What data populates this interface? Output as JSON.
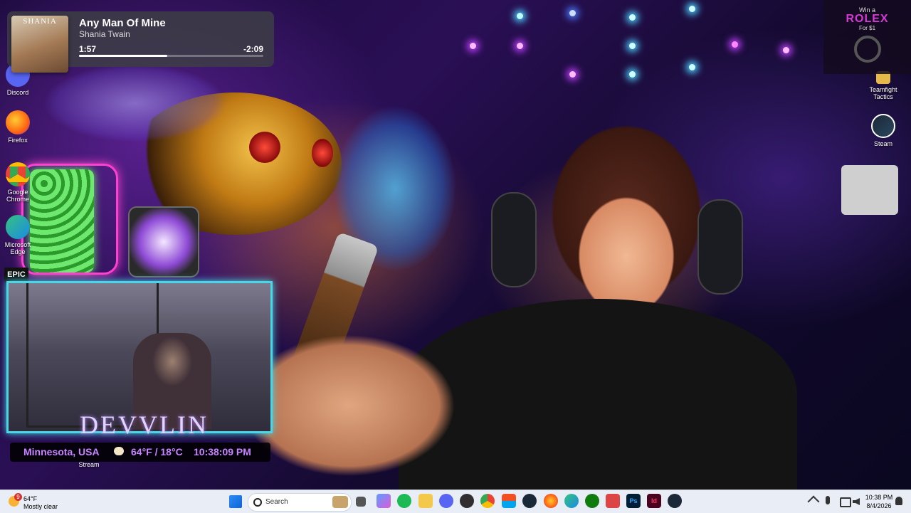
{
  "media": {
    "album_text": "SHANIA",
    "title": "Any Man Of Mine",
    "artist": "Shania Twain",
    "elapsed": "1:57",
    "remaining": "-2:09",
    "progress_fraction": 0.48
  },
  "desktop_icons": {
    "discord": "Discord",
    "firefox": "Firefox",
    "chrome_line1": "Google",
    "chrome_line2": "Chrome",
    "edge_line1": "Microsoft",
    "edge_line2": "Edge",
    "epic": "EPIC",
    "tft_line1": "Teamfight",
    "tft_line2": "Tactics",
    "steam": "Steam",
    "stream": "Stream"
  },
  "ad": {
    "line1": "Win a",
    "line2": "ROLEX",
    "line3": "For $1"
  },
  "webcam": {
    "name_overlay": "DEVVLIN"
  },
  "location_bar": {
    "location": "Minnesota, USA",
    "temps": "64°F / 18°C",
    "time": "10:38:09 PM"
  },
  "taskbar": {
    "weather_temp": "64°F",
    "weather_desc": "Mostly clear",
    "weather_badge": "9",
    "search_placeholder": "Search",
    "clock_time": "10:38 PM",
    "clock_date": "8/4/2026",
    "pinned_icons": [
      "start-icon",
      "search",
      "task-view-icon",
      "copilot-icon",
      "spotify-icon",
      "file-explorer-icon",
      "discord-icon",
      "obs-icon",
      "chrome-icon",
      "store-icon",
      "steam-icon",
      "firefox-icon",
      "edge-icon",
      "xbox-icon",
      "snipping-icon",
      "photoshop-icon",
      "indesign-icon",
      "steam-alt-icon"
    ],
    "tray_icons": [
      "chevron-up-icon",
      "microphone-icon",
      "network-icon",
      "volume-icon",
      "notification-icon"
    ]
  },
  "colors": {
    "accent_purple": "#c684ff",
    "cam_border": "#49d6e6",
    "rolex_pink": "#d63ad6"
  }
}
